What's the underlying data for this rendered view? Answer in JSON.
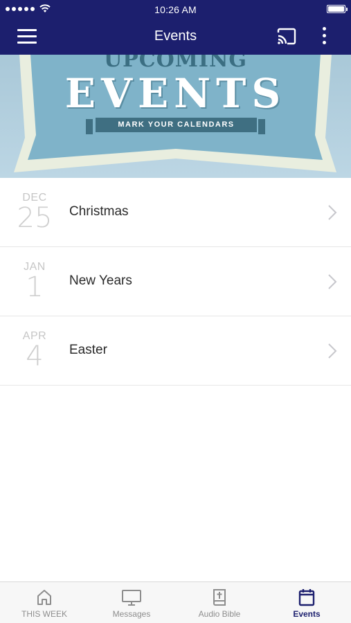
{
  "status_bar": {
    "time": "10:26 AM"
  },
  "nav": {
    "title": "Events",
    "menu_icon": "hamburger-menu-icon",
    "cast_icon": "cast-icon",
    "more_icon": "more-vertical-icon"
  },
  "banner": {
    "overline": "UPCOMING",
    "title": "EVENTS",
    "subtitle": "MARK YOUR CALENDARS"
  },
  "events": [
    {
      "month": "DEC",
      "day": "25",
      "name": "Christmas"
    },
    {
      "month": "JAN",
      "day": "1",
      "name": "New Years"
    },
    {
      "month": "APR",
      "day": "4",
      "name": "Easter"
    }
  ],
  "tabs": [
    {
      "label": "THIS WEEK",
      "icon": "home-icon",
      "active": false
    },
    {
      "label": "Messages",
      "icon": "monitor-icon",
      "active": false
    },
    {
      "label": "Audio Bible",
      "icon": "bible-icon",
      "active": false
    },
    {
      "label": "Events",
      "icon": "calendar-icon",
      "active": true
    }
  ],
  "colors": {
    "nav_background": "#1c1f6e",
    "active_tab": "#1c1f6e",
    "inactive_tab": "#8d8d8d",
    "banner_background": "#a9c8d8"
  }
}
